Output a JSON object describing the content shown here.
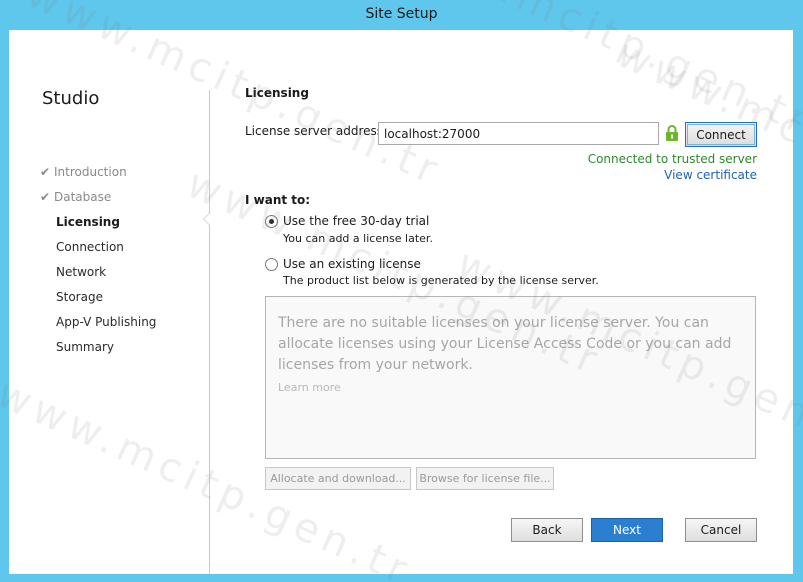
{
  "window": {
    "title": "Site Setup"
  },
  "sidebar": {
    "app_name": "Studio",
    "check_glyph": "✔",
    "steps": [
      {
        "label": "Introduction",
        "state": "done"
      },
      {
        "label": "Database",
        "state": "done"
      },
      {
        "label": "Licensing",
        "state": "active"
      },
      {
        "label": "Connection",
        "state": "pending"
      },
      {
        "label": "Network",
        "state": "pending"
      },
      {
        "label": "Storage",
        "state": "pending"
      },
      {
        "label": "App-V Publishing",
        "state": "pending"
      },
      {
        "label": "Summary",
        "state": "pending"
      }
    ]
  },
  "licensing": {
    "section_title": "Licensing",
    "server_label": "License server address:",
    "server_value": "localhost:27000",
    "lock_icon": "lock-icon",
    "connect_label": "Connect",
    "status_text": "Connected to trusted server",
    "view_certificate": "View certificate",
    "want_label": "I want to:",
    "options": [
      {
        "label": "Use the free 30-day trial",
        "sub": "You can add a license later.",
        "selected": true
      },
      {
        "label": "Use an existing license",
        "sub": "The product list below is generated by the license server.",
        "selected": false
      }
    ],
    "empty_message": "There are no suitable licenses on your license server. You can allocate licenses using your License Access Code or you can add licenses from your network.",
    "learn_more": "Learn more",
    "allocate_label": "Allocate and download...",
    "browse_label": "Browse for license file..."
  },
  "footer": {
    "back": "Back",
    "next": "Next",
    "cancel": "Cancel"
  },
  "watermark": {
    "text": "www.mcitp.gen.tr"
  },
  "colors": {
    "titlebar": "#5fc7ec",
    "success": "#2d8a2d",
    "link": "#1b64b5",
    "primary": "#2b7fd0",
    "lock": "#6cb52d"
  }
}
